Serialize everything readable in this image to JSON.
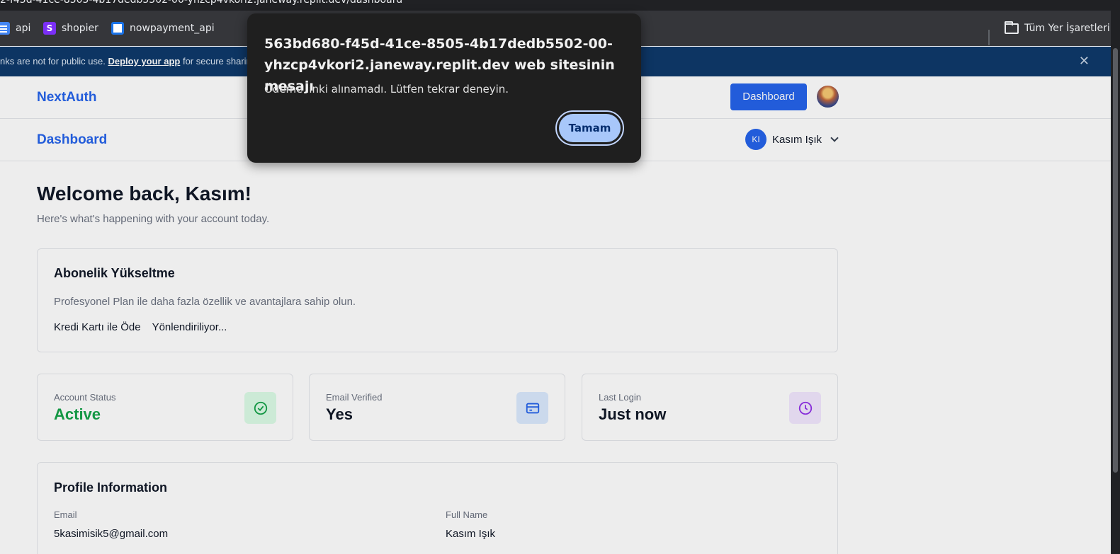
{
  "browser": {
    "url_partial": "2-f45d-41ce-8505-4b17dedb5502-00-yhzcp4vkori2.janeway.replit.dev/dashboard",
    "bookmarks": [
      {
        "label": "api",
        "icon": "docs-icon"
      },
      {
        "label": "shopier",
        "icon": "shopier-icon"
      },
      {
        "label": "nowpayment_api",
        "icon": "nowpayment-icon"
      }
    ],
    "bookmarks_folder": "Tüm Yer İşaretleri"
  },
  "banner": {
    "text_before": "nks are not for public use. ",
    "link": "Deploy your app",
    "text_after": " for secure sharing"
  },
  "header": {
    "brand": "NextAuth",
    "dashboard_button": "Dashboard"
  },
  "subheader": {
    "title": "Dashboard",
    "user_initials": "KI",
    "user_name": "Kasım Işık"
  },
  "welcome": {
    "title": "Welcome back, Kasım!",
    "subtitle": "Here's what's happening with your account today."
  },
  "upgrade": {
    "title": "Abonelik Yükseltme",
    "description": "Profesyonel Plan ile daha fazla özellik ve avantajlara sahip olun.",
    "pay_label": "Kredi Kartı ile Öde",
    "status": "Yönlendiriliyor..."
  },
  "stats": [
    {
      "label": "Account Status",
      "value": "Active",
      "color": "#16a34a",
      "icon": "check-circle-icon"
    },
    {
      "label": "Email Verified",
      "value": "Yes",
      "color": "#111827",
      "icon": "card-icon"
    },
    {
      "label": "Last Login",
      "value": "Just now",
      "color": "#111827",
      "icon": "clock-icon"
    }
  ],
  "profile": {
    "title": "Profile Information",
    "email_label": "Email",
    "email": "5kasimisik5@gmail.com",
    "name_label": "Full Name",
    "name": "Kasım Işık"
  },
  "dialog": {
    "title": "563bd680-f45d-41ce-8505-4b17dedb5502-00-yhzcp4vkori2.janeway.replit.dev web sitesinin mesajı",
    "message": "Ödeme linki alınamadı. Lütfen tekrar deneyin.",
    "ok_button": "Tamam"
  },
  "colors": {
    "accent": "#2563eb",
    "banner": "#0e3a6b",
    "dialog_bg": "#1f1f1f",
    "dialog_button": "#a8c7fa"
  }
}
